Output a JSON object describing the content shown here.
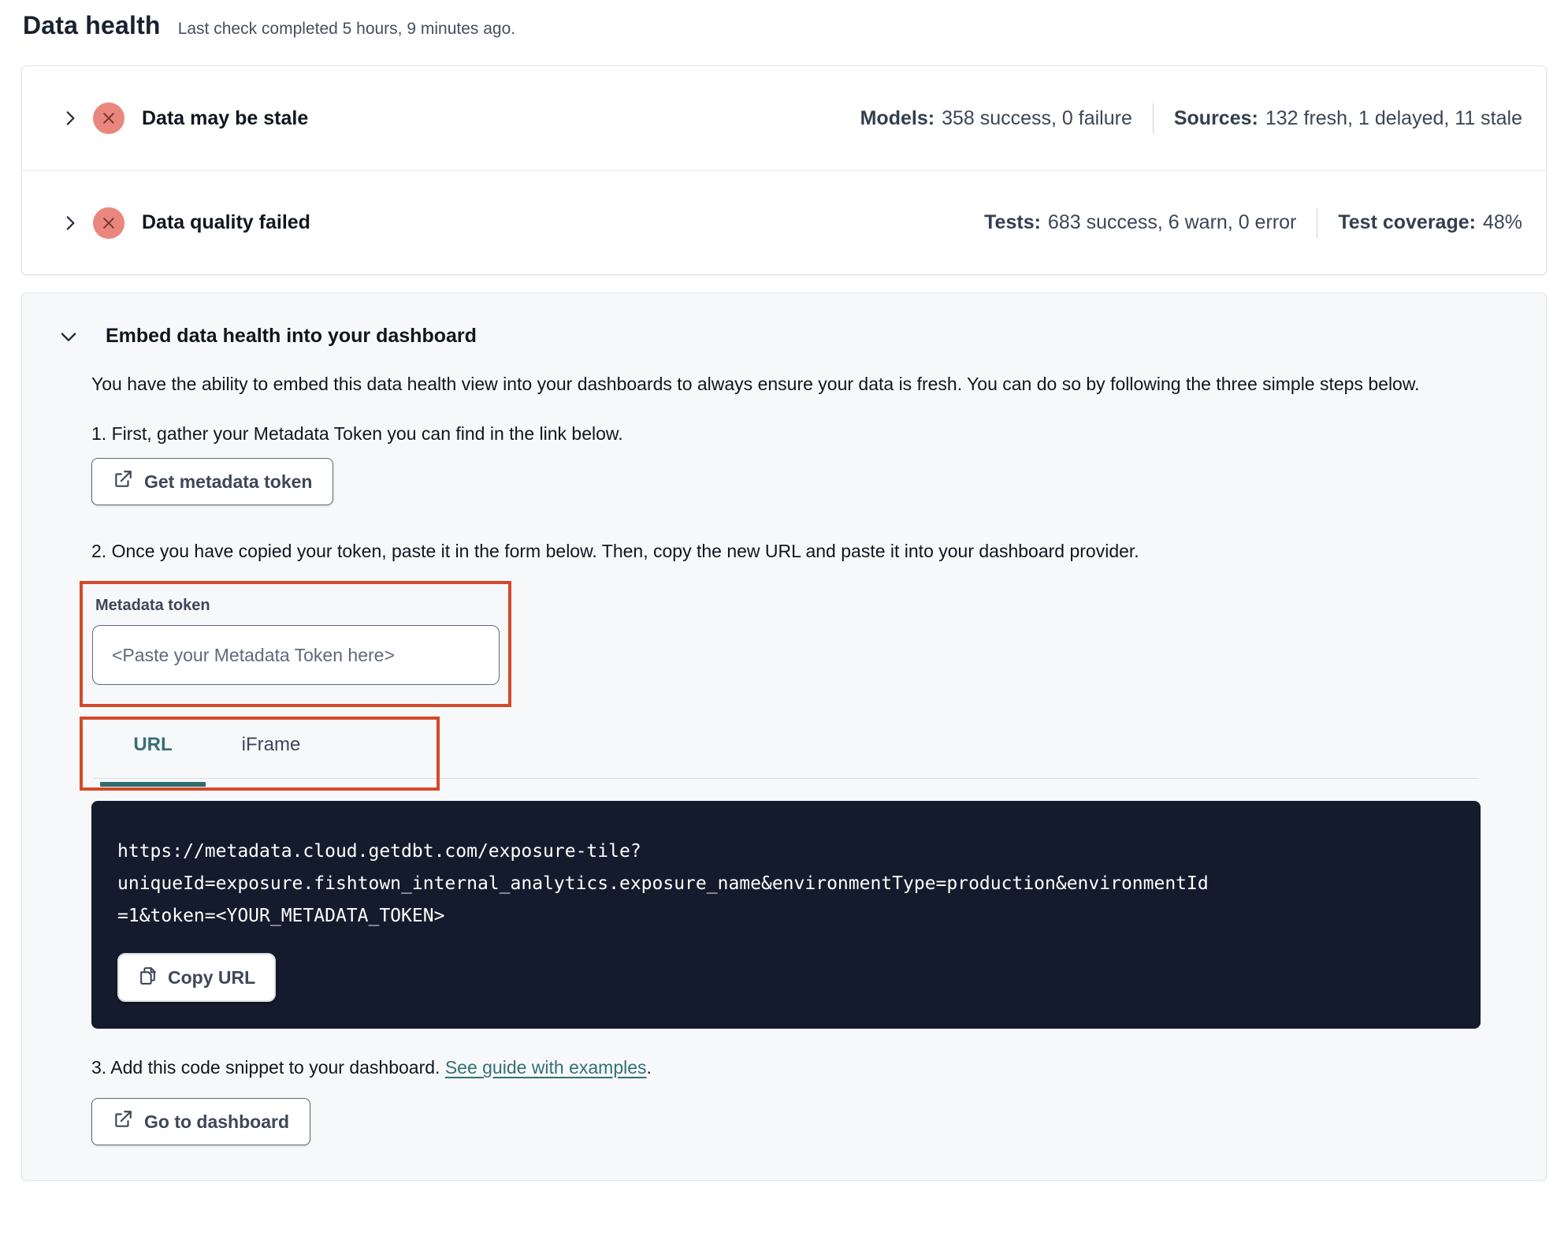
{
  "header": {
    "title": "Data health",
    "subtitle": "Last check completed 5 hours, 9 minutes ago."
  },
  "status_panel": {
    "rows": [
      {
        "title": "Data may be stale",
        "stat1_label": "Models:",
        "stat1_value": "358 success, 0 failure",
        "stat2_label": "Sources:",
        "stat2_value": "132 fresh, 1 delayed, 11 stale"
      },
      {
        "title": "Data quality failed",
        "stat1_label": "Tests:",
        "stat1_value": "683 success, 6 warn, 0 error",
        "stat2_label": "Test coverage:",
        "stat2_value": "48%"
      }
    ]
  },
  "embed_panel": {
    "title": "Embed data health into your dashboard",
    "description": "You have the ability to embed this data health view into your dashboards to always ensure your data is fresh. You can do so by following the three simple steps below.",
    "step1_text": "1. First, gather your Metadata Token you can find in the link below.",
    "get_token_button": "Get metadata token",
    "step2_text": "2. Once you have copied your token, paste it in the form below. Then, copy the new URL and paste it into your dashboard provider.",
    "token_field": {
      "label": "Metadata token",
      "placeholder": "<Paste your Metadata Token here>",
      "value": ""
    },
    "tabs": {
      "url_label": "URL",
      "iframe_label": "iFrame",
      "active": "URL"
    },
    "code_block": {
      "url": "https://metadata.cloud.getdbt.com/exposure-tile?uniqueId=exposure.fishtown_internal_analytics.exposure_name&environmentType=production&environmentId=1&token=<YOUR_METADATA_TOKEN>",
      "lines": [
        "https://metadata.cloud.getdbt.com/exposure-tile?",
        "uniqueId=exposure.fishtown_internal_analytics.exposure_name&environmentType=production&environmentId",
        "=1&token=<YOUR_METADATA_TOKEN>"
      ],
      "copy_button": "Copy URL"
    },
    "step3_text": "3. Add this code snippet to your dashboard. ",
    "step3_link": "See guide with examples",
    "step3_suffix": ".",
    "dashboard_button": "Go to dashboard"
  },
  "colors": {
    "accent_teal": "#337174",
    "error_badge": "#e9867d",
    "annotation_red": "#d4492b",
    "code_background": "#141b2c"
  }
}
